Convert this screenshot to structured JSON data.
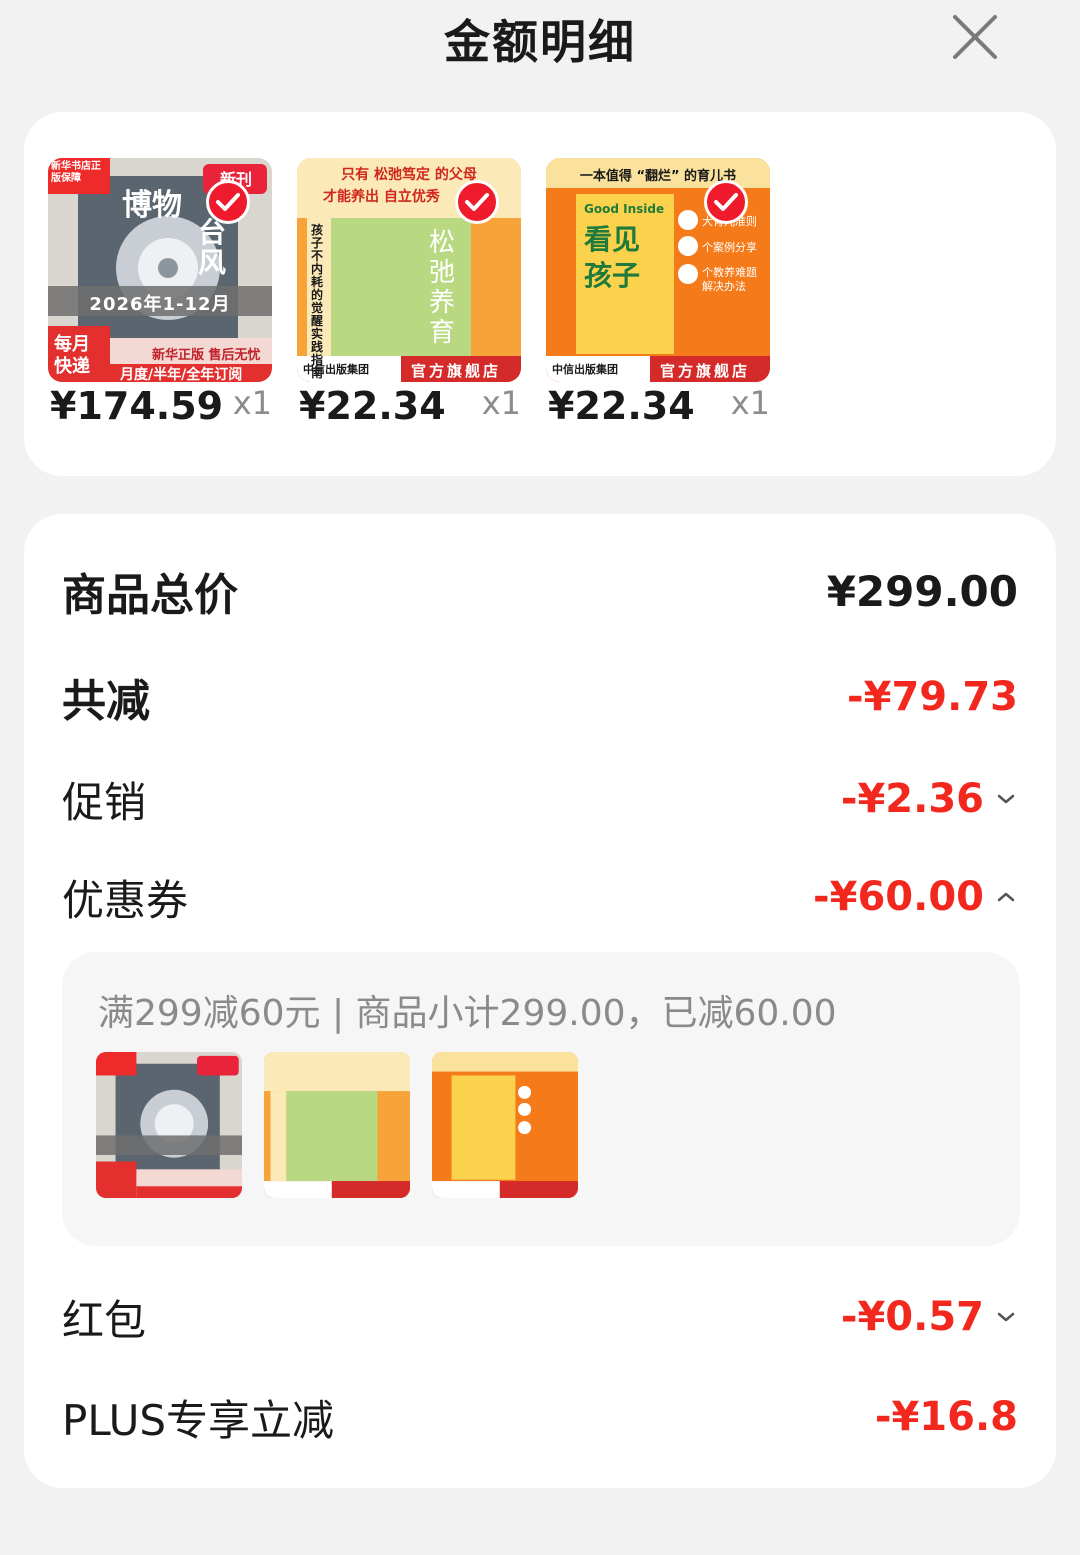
{
  "header": {
    "title": "金额明细",
    "close_icon": "close-icon"
  },
  "products": [
    {
      "price": "¥174.59",
      "qty": "x1",
      "theme": "magazine",
      "texts": {
        "tag": "新华书店正版保障",
        "badge": "新刊",
        "name": "博物",
        "sub": "台风",
        "banner": "2026年1-12月",
        "corner": "每月快递",
        "promo1": "新华正版 售后无忧",
        "promo2": "月度/半年/全年订阅"
      }
    },
    {
      "price": "¥22.34",
      "qty": "x1",
      "theme": "green",
      "texts": {
        "top1": "只有 松弛笃定 的父母",
        "top2": "才能养出 自立优秀",
        "side": "孩子不内耗的觉醒实践指南",
        "title": "松弛养育",
        "foot1": "中信出版集团",
        "foot2": "官方旗舰店"
      }
    },
    {
      "price": "¥22.34",
      "qty": "x1",
      "theme": "orange",
      "texts": {
        "top": "一本值得 “翻烂” 的育儿书",
        "en": "Good Inside",
        "title1": "看见",
        "title2": "孩子",
        "b1": "大育儿准则",
        "b2": "个案例分享",
        "b3": "个教养难题 解决办法",
        "foot1": "中信出版集团",
        "foot2": "官方旗舰店"
      }
    }
  ],
  "summary": {
    "total_label": "商品总价",
    "total_value": "¥299.00",
    "reduce_label": "共减",
    "reduce_value": "-¥79.73",
    "promo_label": "促销",
    "promo_value": "-¥2.36",
    "coupon_label": "优惠券",
    "coupon_value": "-¥60.00",
    "coupon_detail": "满299减60元 | 商品小计299.00，已减60.00",
    "redpacket_label": "红包",
    "redpacket_value": "-¥0.57",
    "plus_label": "PLUS专享立减",
    "plus_value": "-¥16.8"
  },
  "colors": {
    "accent_red": "#f2281e",
    "check_red": "#ef1b2d",
    "muted": "#8a8a8a"
  }
}
